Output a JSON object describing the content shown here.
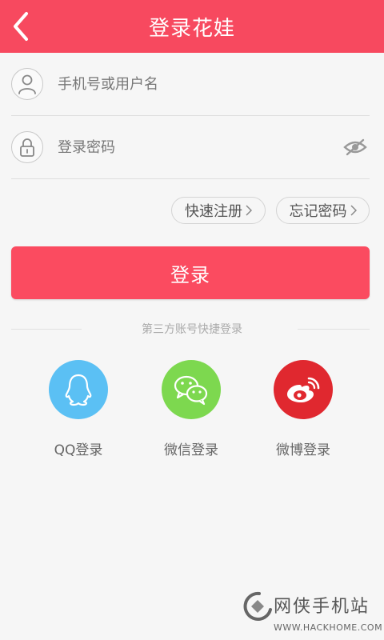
{
  "header": {
    "title": "登录花娃"
  },
  "form": {
    "username": {
      "placeholder": "手机号或用户名",
      "value": ""
    },
    "password": {
      "placeholder": "登录密码",
      "value": ""
    }
  },
  "links": {
    "register": "快速注册",
    "forgot": "忘记密码"
  },
  "login_button": "登录",
  "third_party": {
    "label": "第三方账号快捷登录",
    "items": [
      {
        "label": "QQ登录",
        "color": "#5bc0f4",
        "icon": "qq-icon"
      },
      {
        "label": "微信登录",
        "color": "#7dd84f",
        "icon": "wechat-icon"
      },
      {
        "label": "微博登录",
        "color": "#e0282f",
        "icon": "weibo-icon"
      }
    ]
  },
  "watermark": {
    "name": "网侠手机站",
    "url": "WWW.HACKHOME.COM"
  },
  "colors": {
    "accent": "#f7495f",
    "button": "#fb4b60"
  }
}
